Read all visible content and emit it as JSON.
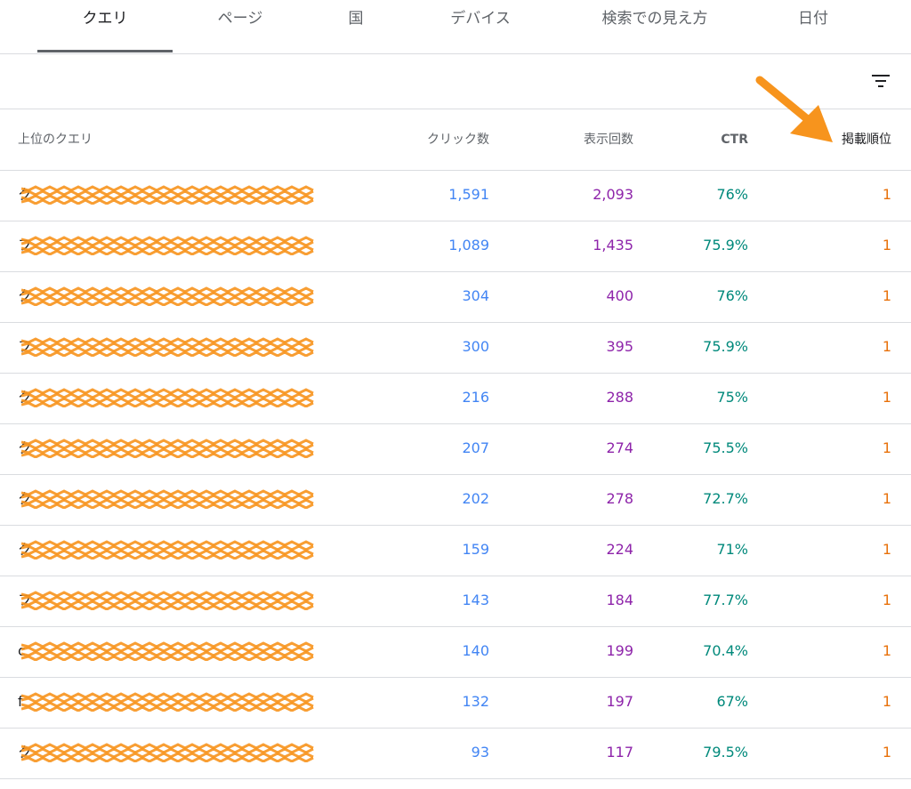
{
  "tabs": [
    {
      "label": "クエリ",
      "active": true
    },
    {
      "label": "ページ",
      "active": false
    },
    {
      "label": "国",
      "active": false
    },
    {
      "label": "デバイス",
      "active": false
    },
    {
      "label": "検索での見え方",
      "active": false
    },
    {
      "label": "日付",
      "active": false
    }
  ],
  "filter": {
    "icon": "filter-list-icon"
  },
  "table": {
    "headers": {
      "query": "上位のクエリ",
      "clicks": "クリック数",
      "impressions": "表示回数",
      "ctr": "CTR",
      "position": "掲載順位"
    },
    "rows": [
      {
        "query": "ク",
        "clicks": "1,591",
        "impressions": "2,093",
        "ctr": "76%",
        "position": "1"
      },
      {
        "query": "フ",
        "clicks": "1,089",
        "impressions": "1,435",
        "ctr": "75.9%",
        "position": "1"
      },
      {
        "query": "ク",
        "clicks": "304",
        "impressions": "400",
        "ctr": "76%",
        "position": "1"
      },
      {
        "query": "フ",
        "clicks": "300",
        "impressions": "395",
        "ctr": "75.9%",
        "position": "1"
      },
      {
        "query": "ク",
        "clicks": "216",
        "impressions": "288",
        "ctr": "75%",
        "position": "1"
      },
      {
        "query": "ク",
        "clicks": "207",
        "impressions": "274",
        "ctr": "75.5%",
        "position": "1"
      },
      {
        "query": "ク",
        "clicks": "202",
        "impressions": "278",
        "ctr": "72.7%",
        "position": "1"
      },
      {
        "query": "ク",
        "clicks": "159",
        "impressions": "224",
        "ctr": "71%",
        "position": "1"
      },
      {
        "query": "フ",
        "clicks": "143",
        "impressions": "184",
        "ctr": "77.7%",
        "position": "1"
      },
      {
        "query": "c",
        "clicks": "140",
        "impressions": "199",
        "ctr": "70.4%",
        "position": "1"
      },
      {
        "query": "f",
        "clicks": "132",
        "impressions": "197",
        "ctr": "67%",
        "position": "1"
      },
      {
        "query": "ク",
        "clicks": "93",
        "impressions": "117",
        "ctr": "79.5%",
        "position": "1"
      }
    ]
  },
  "colors": {
    "clicks": "#4285f4",
    "impressions": "#8e24aa",
    "ctr": "#00897b",
    "position": "#e8710a",
    "annotation": "#f7941d"
  },
  "annotation": {
    "icon": "arrow-annotation-icon"
  }
}
